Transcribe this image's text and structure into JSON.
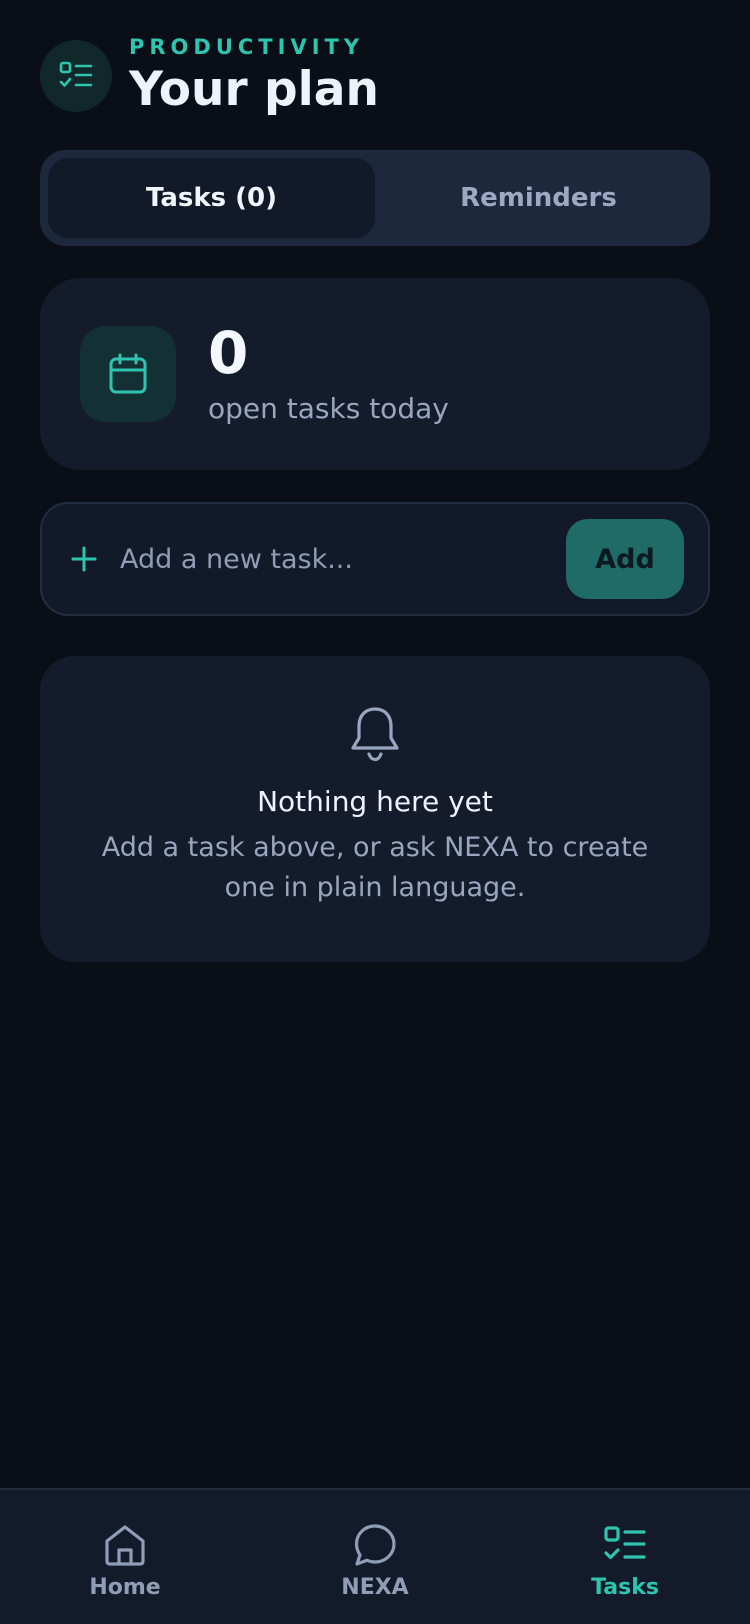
{
  "header": {
    "eyebrow": "PRODUCTIVITY",
    "title": "Your plan",
    "icon": "task-list-icon"
  },
  "tabs": [
    {
      "label": "Tasks (0)",
      "active": true
    },
    {
      "label": "Reminders",
      "active": false
    }
  ],
  "stats": {
    "count": "0",
    "label": "open tasks today",
    "icon": "calendar-icon"
  },
  "add_task": {
    "placeholder": "Add a new task...",
    "value": "",
    "button_label": "Add"
  },
  "empty_state": {
    "icon": "bell-icon",
    "title": "Nothing here yet",
    "subtitle": "Add a task above, or ask NEXA to create one in plain language."
  },
  "nav": {
    "items": [
      {
        "label": "Home",
        "icon": "home-icon",
        "active": false
      },
      {
        "label": "NEXA",
        "icon": "chat-bubble-icon",
        "active": false
      },
      {
        "label": "Tasks",
        "icon": "task-list-icon",
        "active": true
      }
    ]
  },
  "colors": {
    "background": "#0a0e17",
    "accent": "#2ec4b0",
    "card": "#141c2c",
    "muted_text": "#98a6bf"
  }
}
